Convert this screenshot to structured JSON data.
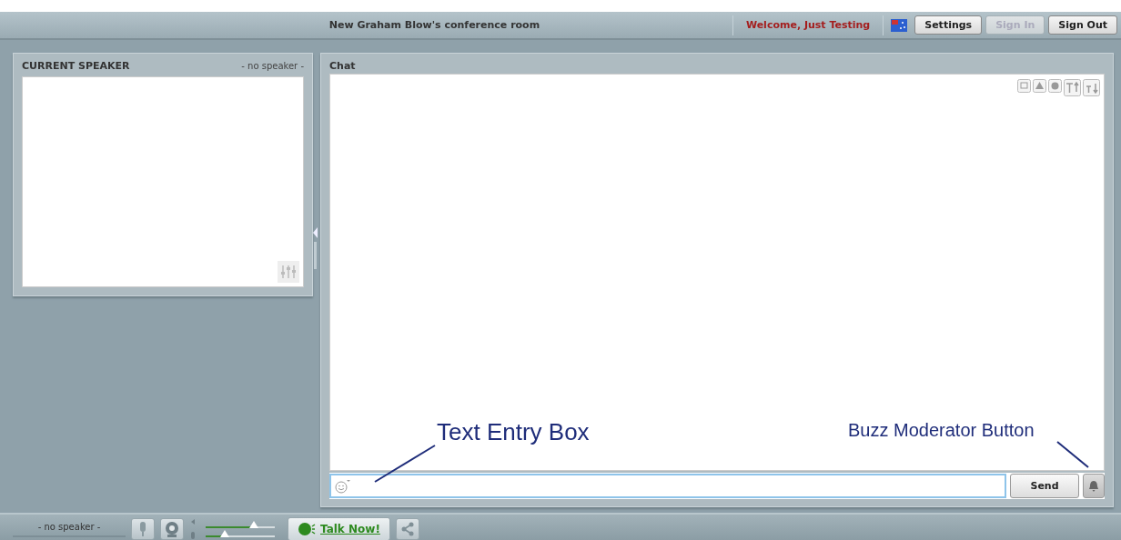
{
  "header": {
    "room_title": "New Graham Blow's conference room",
    "welcome": "Welcome, Just Testing",
    "buttons": [
      {
        "label": "Settings",
        "disabled": false
      },
      {
        "label": "Sign In",
        "disabled": true
      },
      {
        "label": "Sign Out",
        "disabled": false
      }
    ]
  },
  "speaker_panel": {
    "title": "CURRENT SPEAKER",
    "status": "- no speaker -"
  },
  "chat_panel": {
    "title": "Chat",
    "send_label": "Send"
  },
  "annotations": [
    {
      "kind": "left",
      "text": "Text Entry Box"
    },
    {
      "kind": "right",
      "text": "Buzz Moderator Button"
    }
  ],
  "bottom_bar": {
    "speaker_status": "- no speaker -",
    "sliders": [
      {
        "level": 0.7
      },
      {
        "level": 0.28
      }
    ],
    "talk_label": "Talk Now!"
  }
}
